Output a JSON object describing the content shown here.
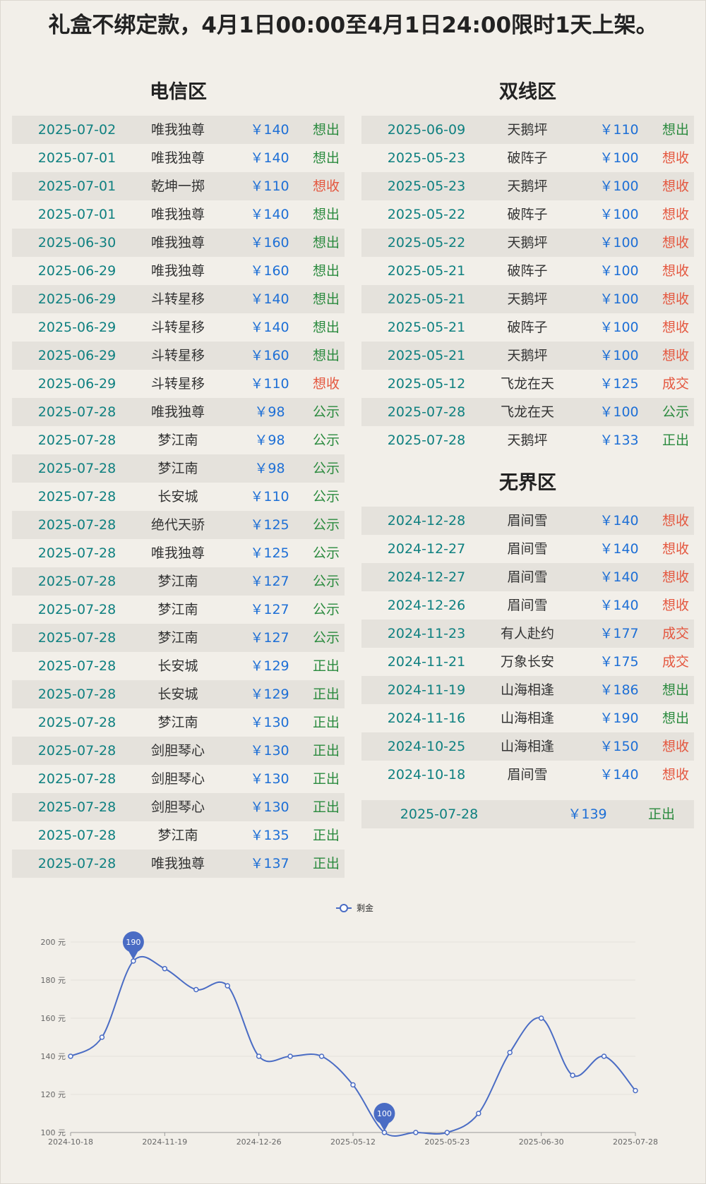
{
  "headline": "礼盒不绑定款，4月1日00:00至4月1日24:00限时1天上架。",
  "colors": {
    "date": "#0f8080",
    "price": "#1d6fd6",
    "want_sell": "#2a8a3e",
    "want_buy": "#e4573f",
    "line": "#4a6cc4"
  },
  "dianxin": {
    "title": "电信区",
    "rows": [
      {
        "date": "2025-07-02",
        "name": "唯我独尊",
        "price": "￥140",
        "status": "想出",
        "tone": "green"
      },
      {
        "date": "2025-07-01",
        "name": "唯我独尊",
        "price": "￥140",
        "status": "想出",
        "tone": "green"
      },
      {
        "date": "2025-07-01",
        "name": "乾坤一掷",
        "price": "￥110",
        "status": "想收",
        "tone": "red"
      },
      {
        "date": "2025-07-01",
        "name": "唯我独尊",
        "price": "￥140",
        "status": "想出",
        "tone": "green"
      },
      {
        "date": "2025-06-30",
        "name": "唯我独尊",
        "price": "￥160",
        "status": "想出",
        "tone": "green"
      },
      {
        "date": "2025-06-29",
        "name": "唯我独尊",
        "price": "￥160",
        "status": "想出",
        "tone": "green"
      },
      {
        "date": "2025-06-29",
        "name": "斗转星移",
        "price": "￥140",
        "status": "想出",
        "tone": "green"
      },
      {
        "date": "2025-06-29",
        "name": "斗转星移",
        "price": "￥140",
        "status": "想出",
        "tone": "green"
      },
      {
        "date": "2025-06-29",
        "name": "斗转星移",
        "price": "￥160",
        "status": "想出",
        "tone": "green"
      },
      {
        "date": "2025-06-29",
        "name": "斗转星移",
        "price": "￥110",
        "status": "想收",
        "tone": "red"
      },
      {
        "date": "2025-07-28",
        "name": "唯我独尊",
        "price": "￥98",
        "status": "公示",
        "tone": "green"
      },
      {
        "date": "2025-07-28",
        "name": "梦江南",
        "price": "￥98",
        "status": "公示",
        "tone": "green"
      },
      {
        "date": "2025-07-28",
        "name": "梦江南",
        "price": "￥98",
        "status": "公示",
        "tone": "green"
      },
      {
        "date": "2025-07-28",
        "name": "长安城",
        "price": "￥110",
        "status": "公示",
        "tone": "green"
      },
      {
        "date": "2025-07-28",
        "name": "绝代天骄",
        "price": "￥125",
        "status": "公示",
        "tone": "green"
      },
      {
        "date": "2025-07-28",
        "name": "唯我独尊",
        "price": "￥125",
        "status": "公示",
        "tone": "green"
      },
      {
        "date": "2025-07-28",
        "name": "梦江南",
        "price": "￥127",
        "status": "公示",
        "tone": "green"
      },
      {
        "date": "2025-07-28",
        "name": "梦江南",
        "price": "￥127",
        "status": "公示",
        "tone": "green"
      },
      {
        "date": "2025-07-28",
        "name": "梦江南",
        "price": "￥127",
        "status": "公示",
        "tone": "green"
      },
      {
        "date": "2025-07-28",
        "name": "长安城",
        "price": "￥129",
        "status": "正出",
        "tone": "green"
      },
      {
        "date": "2025-07-28",
        "name": "长安城",
        "price": "￥129",
        "status": "正出",
        "tone": "green"
      },
      {
        "date": "2025-07-28",
        "name": "梦江南",
        "price": "￥130",
        "status": "正出",
        "tone": "green"
      },
      {
        "date": "2025-07-28",
        "name": "剑胆琴心",
        "price": "￥130",
        "status": "正出",
        "tone": "green"
      },
      {
        "date": "2025-07-28",
        "name": "剑胆琴心",
        "price": "￥130",
        "status": "正出",
        "tone": "green"
      },
      {
        "date": "2025-07-28",
        "name": "剑胆琴心",
        "price": "￥130",
        "status": "正出",
        "tone": "green"
      },
      {
        "date": "2025-07-28",
        "name": "梦江南",
        "price": "￥135",
        "status": "正出",
        "tone": "green"
      },
      {
        "date": "2025-07-28",
        "name": "唯我独尊",
        "price": "￥137",
        "status": "正出",
        "tone": "green"
      }
    ]
  },
  "shuangxian": {
    "title": "双线区",
    "rows": [
      {
        "date": "2025-06-09",
        "name": "天鹅坪",
        "price": "￥110",
        "status": "想出",
        "tone": "green"
      },
      {
        "date": "2025-05-23",
        "name": "破阵子",
        "price": "￥100",
        "status": "想收",
        "tone": "red"
      },
      {
        "date": "2025-05-23",
        "name": "天鹅坪",
        "price": "￥100",
        "status": "想收",
        "tone": "red"
      },
      {
        "date": "2025-05-22",
        "name": "破阵子",
        "price": "￥100",
        "status": "想收",
        "tone": "red"
      },
      {
        "date": "2025-05-22",
        "name": "天鹅坪",
        "price": "￥100",
        "status": "想收",
        "tone": "red"
      },
      {
        "date": "2025-05-21",
        "name": "破阵子",
        "price": "￥100",
        "status": "想收",
        "tone": "red"
      },
      {
        "date": "2025-05-21",
        "name": "天鹅坪",
        "price": "￥100",
        "status": "想收",
        "tone": "red"
      },
      {
        "date": "2025-05-21",
        "name": "破阵子",
        "price": "￥100",
        "status": "想收",
        "tone": "red"
      },
      {
        "date": "2025-05-21",
        "name": "天鹅坪",
        "price": "￥100",
        "status": "想收",
        "tone": "red"
      },
      {
        "date": "2025-05-12",
        "name": "飞龙在天",
        "price": "￥125",
        "status": "成交",
        "tone": "red"
      },
      {
        "date": "2025-07-28",
        "name": "飞龙在天",
        "price": "￥100",
        "status": "公示",
        "tone": "green"
      },
      {
        "date": "2025-07-28",
        "name": "天鹅坪",
        "price": "￥133",
        "status": "正出",
        "tone": "green"
      }
    ]
  },
  "wujie": {
    "title": "无界区",
    "rows": [
      {
        "date": "2024-12-28",
        "name": "眉间雪",
        "price": "￥140",
        "status": "想收",
        "tone": "red"
      },
      {
        "date": "2024-12-27",
        "name": "眉间雪",
        "price": "￥140",
        "status": "想收",
        "tone": "red"
      },
      {
        "date": "2024-12-27",
        "name": "眉间雪",
        "price": "￥140",
        "status": "想收",
        "tone": "red"
      },
      {
        "date": "2024-12-26",
        "name": "眉间雪",
        "price": "￥140",
        "status": "想收",
        "tone": "red"
      },
      {
        "date": "2024-11-23",
        "name": "有人赴约",
        "price": "￥177",
        "status": "成交",
        "tone": "red"
      },
      {
        "date": "2024-11-21",
        "name": "万象长安",
        "price": "￥175",
        "status": "成交",
        "tone": "red"
      },
      {
        "date": "2024-11-19",
        "name": "山海相逢",
        "price": "￥186",
        "status": "想出",
        "tone": "green"
      },
      {
        "date": "2024-11-16",
        "name": "山海相逢",
        "price": "￥190",
        "status": "想出",
        "tone": "green"
      },
      {
        "date": "2024-10-25",
        "name": "山海相逢",
        "price": "￥150",
        "status": "想收",
        "tone": "red"
      },
      {
        "date": "2024-10-18",
        "name": "眉间雪",
        "price": "￥140",
        "status": "想收",
        "tone": "red"
      }
    ],
    "summary": {
      "date": "2025-07-28",
      "price": "￥139",
      "status": "正出",
      "tone": "green"
    }
  },
  "chart_data": {
    "type": "line",
    "legend": "剩金",
    "legend_position": "top-center",
    "grid": true,
    "smooth": true,
    "y_unit": "元",
    "ylim": [
      100,
      200
    ],
    "y_ticks": [
      "100 元",
      "120 元",
      "140 元",
      "160 元",
      "180 元",
      "200 元"
    ],
    "x_tick_labels": [
      "2024-10-18",
      "2024-11-19",
      "2024-12-26",
      "2025-05-12",
      "2025-05-23",
      "2025-06-30",
      "2025-07-28"
    ],
    "series": [
      {
        "name": "剩金",
        "x_index": [
          0,
          1,
          2,
          3,
          4,
          5,
          6,
          7,
          8,
          9,
          10,
          11,
          12,
          13,
          14,
          15,
          16,
          17,
          18
        ],
        "values": [
          140,
          150,
          190,
          186,
          175,
          177,
          140,
          140,
          140,
          125,
          100,
          100,
          100,
          110,
          142,
          160,
          130,
          140,
          122
        ]
      }
    ],
    "markers": [
      {
        "label": "190",
        "index": 2,
        "value": 190
      },
      {
        "label": "100",
        "index": 10,
        "value": 100
      }
    ]
  }
}
